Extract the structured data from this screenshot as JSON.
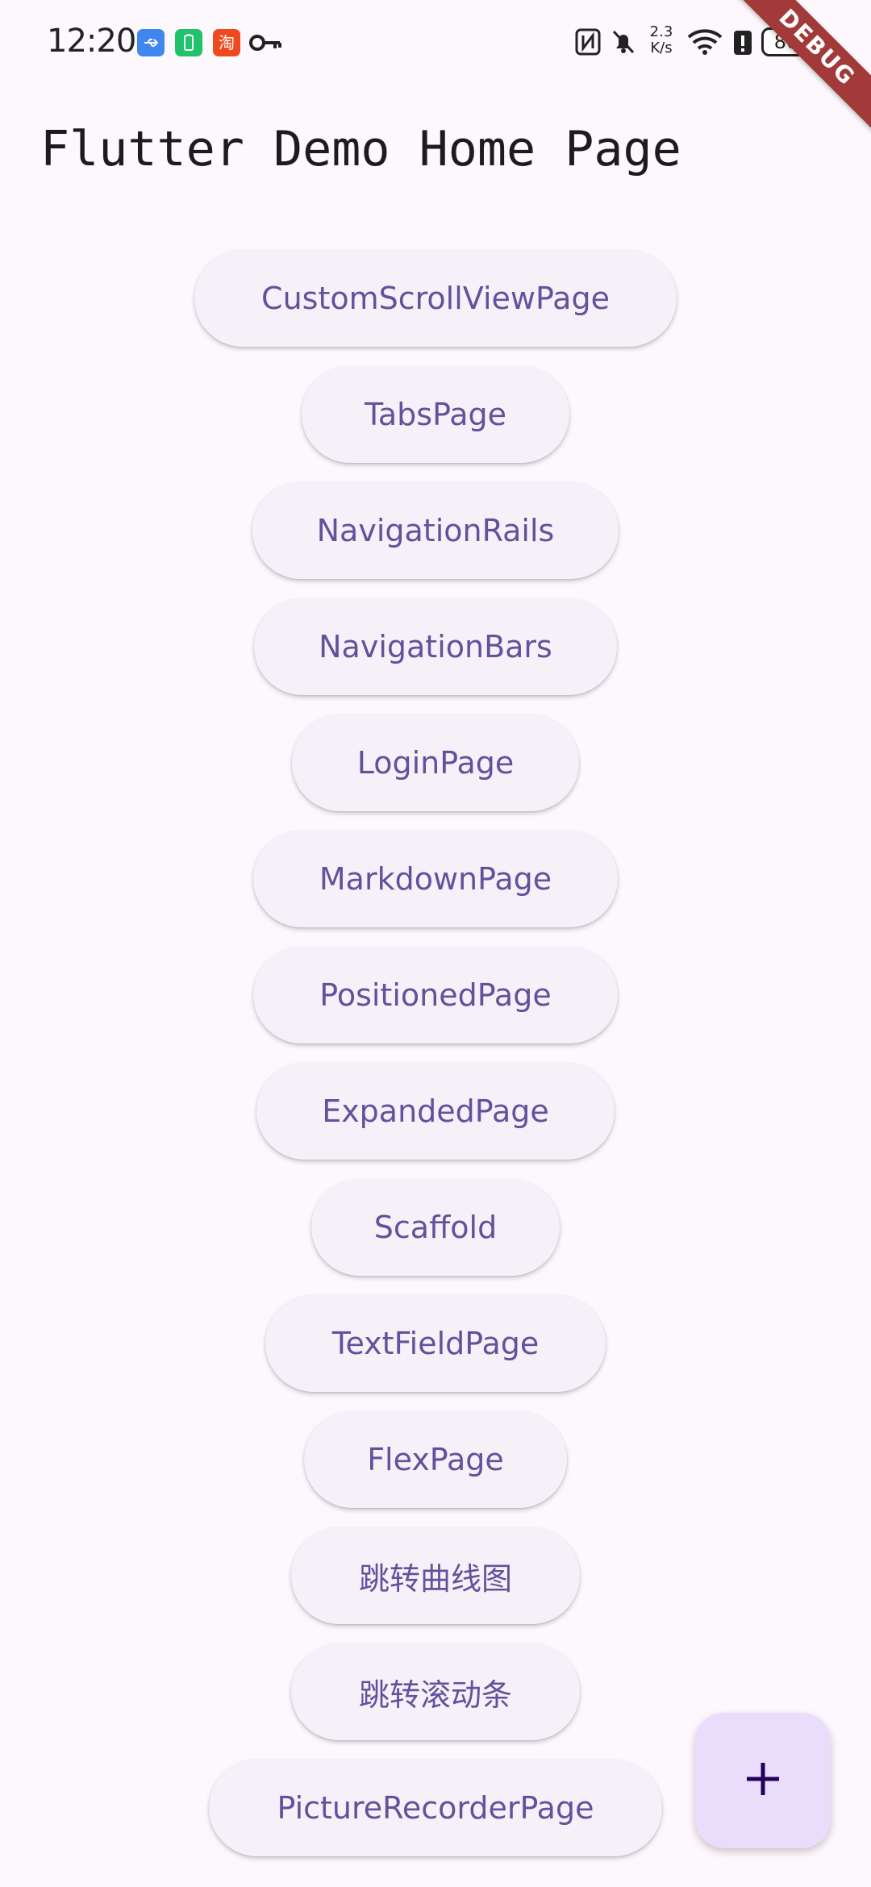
{
  "status_bar": {
    "time": "12:20",
    "net_speed_value": "2.3",
    "net_speed_unit": "K/s",
    "battery_level": "80",
    "icons": [
      "usb-icon",
      "battery-saver-app-icon",
      "taobao-app-icon",
      "key-icon",
      "nfc-icon",
      "mute-icon",
      "wifi-icon",
      "battery-alert-icon",
      "battery-icon"
    ]
  },
  "debug_banner": "DEBUG",
  "page": {
    "title": "Flutter Demo Home Page"
  },
  "buttons": [
    {
      "label": "CustomScrollViewPage"
    },
    {
      "label": "TabsPage"
    },
    {
      "label": "NavigationRails"
    },
    {
      "label": "NavigationBars"
    },
    {
      "label": "LoginPage"
    },
    {
      "label": "MarkdownPage"
    },
    {
      "label": "PositionedPage"
    },
    {
      "label": "ExpandedPage"
    },
    {
      "label": "Scaffold"
    },
    {
      "label": "TextFieldPage"
    },
    {
      "label": "FlexPage"
    },
    {
      "label": "跳转曲线图"
    },
    {
      "label": "跳转滚动条"
    },
    {
      "label": "PictureRecorderPage"
    }
  ],
  "fab": {
    "icon": "plus-icon"
  },
  "colors": {
    "background": "#fdf8fd",
    "button_bg": "#f6f1f8",
    "button_text": "#63519c",
    "fab_bg": "#eaddfc",
    "debug_ribbon": "#a23a3a"
  }
}
